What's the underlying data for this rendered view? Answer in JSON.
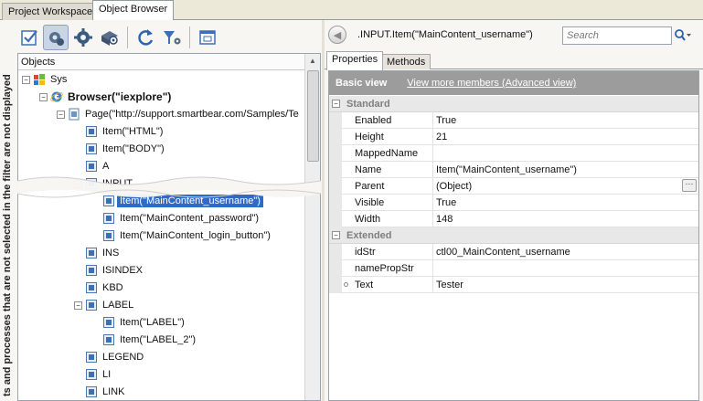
{
  "doc_tabs": [
    "Project Workspace",
    "Object Browser"
  ],
  "vertical_note": "ts and processes that are not selected in the filter are not displayed",
  "toolbar": {
    "icons": [
      "show-checked-icon",
      "process-filter-icon",
      "settings-icon",
      "view-icon",
      "refresh-icon",
      "filter-icon",
      "window-icon"
    ]
  },
  "tree": {
    "header": "Objects",
    "nodes": [
      {
        "label": "Sys",
        "icon": "windows-flag-icon",
        "level": 0,
        "expander": "−",
        "bold": false,
        "selected": false
      },
      {
        "label": "Browser(\"iexplore\")",
        "icon": "ie-icon",
        "level": 1,
        "expander": "−",
        "bold": true,
        "selected": false
      },
      {
        "label": "Page(\"http://support.smartbear.com/Samples/Te",
        "icon": "page-icon",
        "level": 2,
        "expander": "−",
        "bold": false,
        "selected": false
      },
      {
        "label": "Item(\"HTML\")",
        "icon": "item-icon",
        "level": 3,
        "expander": "",
        "bold": false,
        "selected": false
      },
      {
        "label": "Item(\"BODY\")",
        "icon": "item-icon",
        "level": 3,
        "expander": "",
        "bold": false,
        "selected": false
      },
      {
        "label": "A",
        "icon": "item-icon",
        "level": 3,
        "expander": "",
        "bold": false,
        "selected": false
      },
      {
        "label": "INPUT",
        "icon": "item-icon",
        "level": 3,
        "expander": "−",
        "bold": false,
        "selected": false
      },
      {
        "label": "Item(\"MainContent_username\")",
        "icon": "item-icon",
        "level": 4,
        "expander": "",
        "bold": false,
        "selected": true
      },
      {
        "label": "Item(\"MainContent_password\")",
        "icon": "item-icon",
        "level": 4,
        "expander": "",
        "bold": false,
        "selected": false
      },
      {
        "label": "Item(\"MainContent_login_button\")",
        "icon": "item-icon",
        "level": 4,
        "expander": "",
        "bold": false,
        "selected": false
      },
      {
        "label": "INS",
        "icon": "item-icon",
        "level": 3,
        "expander": "",
        "bold": false,
        "selected": false
      },
      {
        "label": "ISINDEX",
        "icon": "item-icon",
        "level": 3,
        "expander": "",
        "bold": false,
        "selected": false
      },
      {
        "label": "KBD",
        "icon": "item-icon",
        "level": 3,
        "expander": "",
        "bold": false,
        "selected": false
      },
      {
        "label": "LABEL",
        "icon": "item-icon",
        "level": 3,
        "expander": "−",
        "bold": false,
        "selected": false
      },
      {
        "label": "Item(\"LABEL\")",
        "icon": "item-icon",
        "level": 4,
        "expander": "",
        "bold": false,
        "selected": false
      },
      {
        "label": "Item(\"LABEL_2\")",
        "icon": "item-icon",
        "level": 4,
        "expander": "",
        "bold": false,
        "selected": false
      },
      {
        "label": "LEGEND",
        "icon": "item-icon",
        "level": 3,
        "expander": "",
        "bold": false,
        "selected": false
      },
      {
        "label": "LI",
        "icon": "item-icon",
        "level": 3,
        "expander": "",
        "bold": false,
        "selected": false
      },
      {
        "label": "LINK",
        "icon": "item-icon",
        "level": 3,
        "expander": "",
        "bold": false,
        "selected": false
      }
    ]
  },
  "right": {
    "object_path": ".INPUT.Item(\"MainContent_username\")",
    "search_placeholder": "Search",
    "tabs": [
      "Properties",
      "Methods"
    ],
    "basic_view": "Basic view",
    "advanced_link": "View more members (Advanced view)",
    "categories": [
      {
        "name": "Standard",
        "properties": [
          {
            "name": "Enabled",
            "value": "True",
            "has_button": false,
            "marker": false
          },
          {
            "name": "Height",
            "value": "21",
            "has_button": false,
            "marker": false
          },
          {
            "name": "MappedName",
            "value": "",
            "has_button": false,
            "marker": false
          },
          {
            "name": "Name",
            "value": "Item(\"MainContent_username\")",
            "has_button": false,
            "marker": false
          },
          {
            "name": "Parent",
            "value": "(Object)",
            "has_button": true,
            "marker": false
          },
          {
            "name": "Visible",
            "value": "True",
            "has_button": false,
            "marker": false
          },
          {
            "name": "Width",
            "value": "148",
            "has_button": false,
            "marker": false
          }
        ]
      },
      {
        "name": "Extended",
        "properties": [
          {
            "name": "idStr",
            "value": "ctl00_MainContent_username",
            "has_button": false,
            "marker": false
          },
          {
            "name": "namePropStr",
            "value": "",
            "has_button": false,
            "marker": false
          },
          {
            "name": "Text",
            "value": "Tester",
            "has_button": false,
            "marker": true
          }
        ]
      }
    ]
  },
  "colors": {
    "selection": "#316ac5",
    "basic_view_bar": "#9c9c9c"
  }
}
